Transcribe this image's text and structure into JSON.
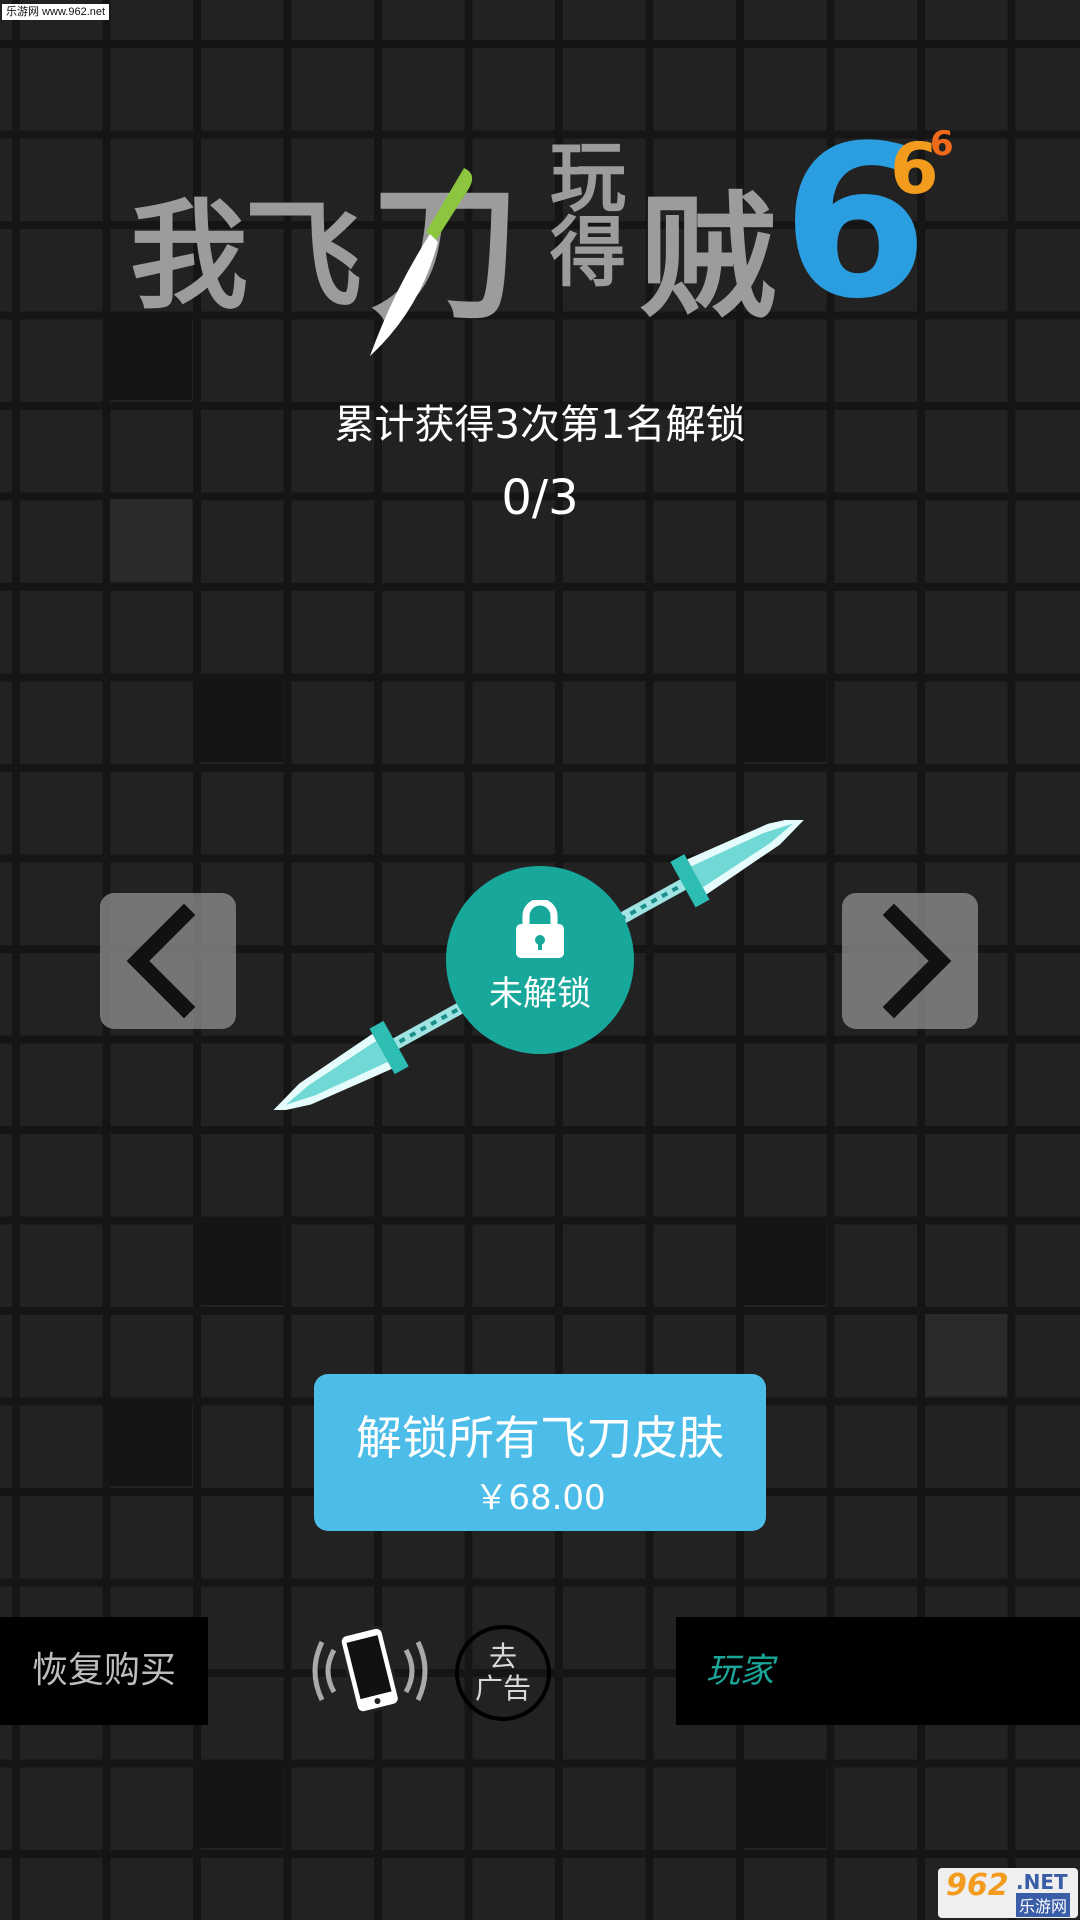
{
  "watermark_top": "乐游网 www.962.net",
  "logo": {
    "part1": "我飞",
    "part2": "刀",
    "part3_line1": "玩",
    "part3_line2": "得",
    "part4": "贼",
    "big_six": "6",
    "mid_six": "6",
    "small_six": "6"
  },
  "unlock_condition": "累计获得3次第1名解锁",
  "unlock_progress": "0/3",
  "lock_badge": {
    "label": "未解锁",
    "icon": "lock-icon"
  },
  "nav": {
    "prev_icon": "chevron-left-icon",
    "next_icon": "chevron-right-icon"
  },
  "purchase": {
    "title": "解锁所有飞刀皮肤",
    "price": "￥68.00"
  },
  "footer": {
    "restore_label": "恢复购买",
    "vibrate_icon": "phone-vibrate-icon",
    "no_ads_line1": "去",
    "no_ads_line2": "广告",
    "player_label": "玩家"
  },
  "watermark_bottom": {
    "num": "962",
    "net": ".NET",
    "cn": "乐游网"
  },
  "colors": {
    "accent_teal": "#17a79b",
    "button_blue": "#4bbde8",
    "logo_blue": "#2a9ee0",
    "logo_orange": "#f29b1d"
  }
}
